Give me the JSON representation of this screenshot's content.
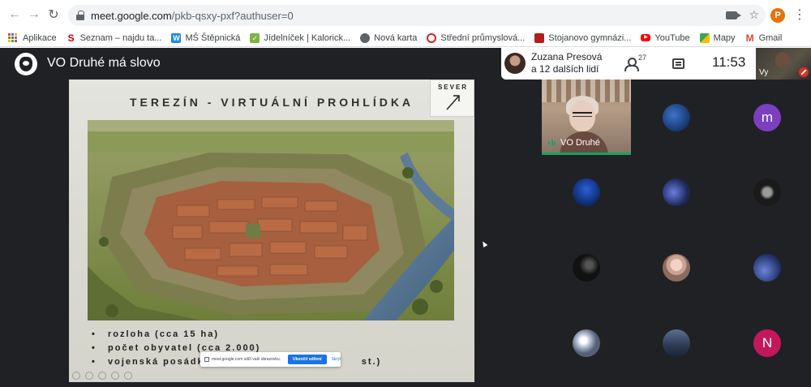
{
  "browser": {
    "url_host": "meet.google.com",
    "url_path": "/pkb-qsxy-pxf?authuser=0",
    "profile_initial": "P",
    "bookmarks": [
      {
        "label": "Aplikace",
        "icon": "apps-grid-icon"
      },
      {
        "label": "Seznam – najdu ta...",
        "icon": "seznam-icon"
      },
      {
        "label": "MŠ Štěpnická",
        "icon": "w-icon"
      },
      {
        "label": "Jídelníček | Kalorick...",
        "icon": "checkbox-icon"
      },
      {
        "label": "Nová karta",
        "icon": "globe-icon"
      },
      {
        "label": "Střední průmyslová...",
        "icon": "school-icon"
      },
      {
        "label": "Stojanovo gymnázi...",
        "icon": "school-flag-icon"
      },
      {
        "label": "YouTube",
        "icon": "youtube-icon"
      },
      {
        "label": "Mapy",
        "icon": "maps-icon"
      },
      {
        "label": "Gmail",
        "icon": "gmail-icon"
      }
    ]
  },
  "meet": {
    "title": "VO Druhé má slovo",
    "presenter": "Zuzana Presová",
    "others": "a 12 dalších lidí",
    "participant_count": "27",
    "clock": "11:53",
    "self_label": "Vy"
  },
  "slide": {
    "title": "TEREZÍN - VIRTUÁLNÍ PROHLÍDKA",
    "compass_label": "SEVER",
    "bullets": [
      {
        "bullet": "•",
        "text": "rozloha (cca 15 ha)"
      },
      {
        "bullet": "•",
        "text": "počet obyvatel (cca 2.000)"
      },
      {
        "bullet": "•",
        "text": "vojenská posádka"
      }
    ],
    "bullet_tail": "st.)"
  },
  "share_banner": {
    "text": "meet.google.com sdílí vaši obrazovku.",
    "stop": "Ukončit sdílení",
    "hide": "Skrýt"
  },
  "tiles": {
    "main_name": "VO Druhé",
    "letter_m": "m",
    "letter_n": "N"
  },
  "colors": {
    "accent": "#1a73e8",
    "speaking": "#1aa260",
    "mute": "#d93025",
    "letter_m_bg": "#7b3fbf",
    "letter_n_bg": "#c2185b"
  }
}
